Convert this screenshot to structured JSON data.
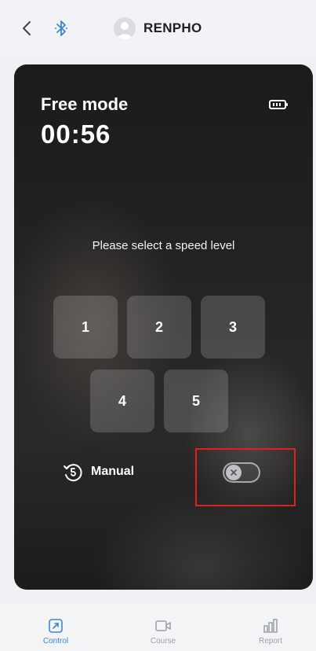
{
  "header": {
    "device_name": "RENPHO"
  },
  "card": {
    "title": "Free mode",
    "timer": "00:56",
    "prompt": "Please select a speed level",
    "speed_levels": [
      "1",
      "2",
      "3",
      "4",
      "5"
    ],
    "manual_label": "Manual",
    "manual_toggle_on": false
  },
  "nav": {
    "items": [
      {
        "label": "Control",
        "active": true
      },
      {
        "label": "Course",
        "active": false
      },
      {
        "label": "Report",
        "active": false
      }
    ]
  },
  "colors": {
    "accent": "#3a86d6",
    "highlight": "#e02020",
    "card_bg": "#242322"
  },
  "icons": [
    "back-arrow-icon",
    "bluetooth-icon",
    "avatar-icon",
    "battery-icon",
    "manual-timer-icon",
    "close-icon",
    "control-icon",
    "course-icon",
    "report-icon"
  ]
}
